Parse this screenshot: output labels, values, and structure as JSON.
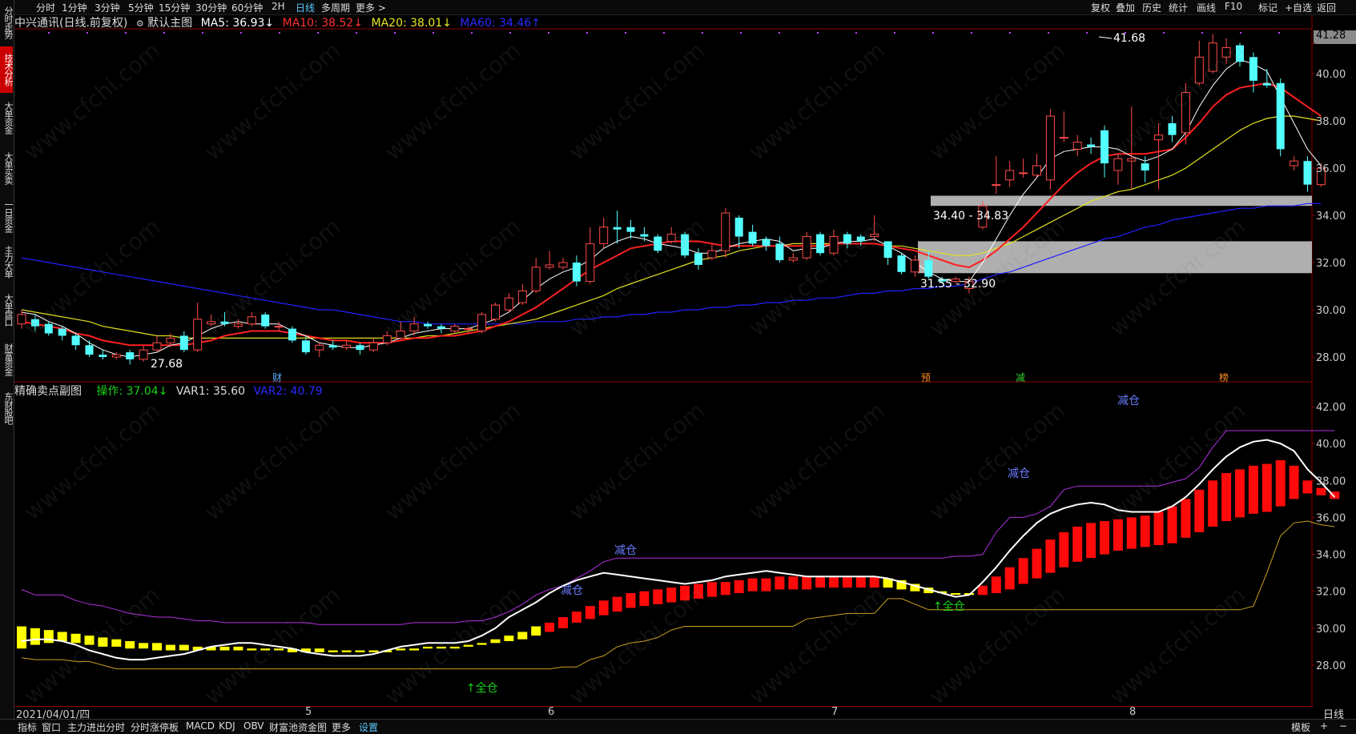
{
  "left_tabs": [
    "分时走势",
    "技术分析",
    "大单资金",
    "大单买卖",
    "一日资金",
    "主力大单",
    "大单盘口",
    "财富资金",
    "东财股吧"
  ],
  "active_left_tab": 1,
  "timeframes": [
    "分时",
    "1分钟",
    "3分钟",
    "5分钟",
    "15分钟",
    "30分钟",
    "60分钟",
    "2H",
    "日线",
    "多周期",
    "更多 >"
  ],
  "active_timeframe": "日线",
  "right_buttons": [
    "复权",
    "叠加",
    "历史",
    "统计",
    "画线",
    "F10",
    "标记",
    "+自选",
    "返回"
  ],
  "main_chart": {
    "stock_title": "中兴通讯(日线.前复权)",
    "template_label": "默认主图",
    "ma5": "MA5: 36.93↓",
    "ma10": "MA10: 38.52↓",
    "ma20": "MA20: 38.01↓",
    "ma60": "MA60: 34.46↑",
    "colors": {
      "ma5": "#ffffff",
      "ma10": "#ff2020",
      "ma20": "#e0e020",
      "ma60": "#2020ff",
      "up": "#ff4a4a",
      "down": "#54ffff"
    },
    "high_label": "41.68",
    "low_label": "27.68",
    "zone_upper_label": "34.40 - 34.83",
    "zone_lower_label": "31.55 - 32.90",
    "markers": [
      "财",
      "预",
      "减",
      "榜"
    ],
    "axis_ticks": [
      "41.28",
      "40.00",
      "38.00",
      "36.00",
      "34.00",
      "32.00",
      "30.00",
      "28.00"
    ]
  },
  "sub_chart": {
    "title": "精确卖点副图",
    "op": "操作: 37.04↓",
    "var1": "VAR1: 35.60",
    "var2": "VAR2: 40.79",
    "labels": [
      "减仓",
      "减仓",
      "减仓",
      "减仓",
      "全仓",
      "全仓"
    ],
    "axis_ticks": [
      "42.00",
      "40.00",
      "38.00",
      "36.00",
      "34.00",
      "32.00",
      "30.00",
      "28.00"
    ]
  },
  "date_axis": {
    "start": "2021/04/01/四",
    "months": [
      "5",
      "6",
      "7",
      "8"
    ],
    "right_label": "日线"
  },
  "bottom_buttons": [
    "指标",
    "窗口",
    "主力进出分时",
    "分时涨停板",
    "MACD",
    "KDJ",
    "OBV",
    "财富池资金图",
    "更多",
    "设置"
  ],
  "active_bottom": "设置",
  "bottom_right": [
    "模板",
    "+",
    "−"
  ],
  "watermark": "www.cfchi.com",
  "candles": [
    [
      29.4,
      29.8,
      29.2,
      30.0
    ],
    [
      29.6,
      29.3,
      29.1,
      29.8
    ],
    [
      29.4,
      29.0,
      28.9,
      29.5
    ],
    [
      29.2,
      28.9,
      28.7,
      29.3
    ],
    [
      28.9,
      28.5,
      28.3,
      29.0
    ],
    [
      28.5,
      28.1,
      28.0,
      28.7
    ],
    [
      28.1,
      28.0,
      27.9,
      28.3
    ],
    [
      28.0,
      28.1,
      27.9,
      28.2
    ],
    [
      28.2,
      27.9,
      27.68,
      28.3
    ],
    [
      27.9,
      28.3,
      27.8,
      28.5
    ],
    [
      28.3,
      28.6,
      28.2,
      28.9
    ],
    [
      28.6,
      28.8,
      28.4,
      29.0
    ],
    [
      28.9,
      28.3,
      28.2,
      29.1
    ],
    [
      28.3,
      29.6,
      28.2,
      30.3
    ],
    [
      29.4,
      29.5,
      29.3,
      29.8
    ],
    [
      29.5,
      29.4,
      29.3,
      29.9
    ],
    [
      29.3,
      29.4,
      29.2,
      29.6
    ],
    [
      29.4,
      29.7,
      29.3,
      29.9
    ],
    [
      29.8,
      29.3,
      29.2,
      29.9
    ],
    [
      29.3,
      29.3,
      29.1,
      29.5
    ],
    [
      29.2,
      28.7,
      28.6,
      29.3
    ],
    [
      28.7,
      28.2,
      28.1,
      28.9
    ],
    [
      28.3,
      28.5,
      28.0,
      28.6
    ],
    [
      28.5,
      28.4,
      28.3,
      28.7
    ],
    [
      28.4,
      28.5,
      28.3,
      28.7
    ],
    [
      28.5,
      28.3,
      28.1,
      28.6
    ],
    [
      28.3,
      28.6,
      28.2,
      28.8
    ],
    [
      28.6,
      28.9,
      28.5,
      29.1
    ],
    [
      28.8,
      29.1,
      28.7,
      29.5
    ],
    [
      29.1,
      29.4,
      28.9,
      29.7
    ],
    [
      29.4,
      29.3,
      29.2,
      29.5
    ],
    [
      29.3,
      29.2,
      29.0,
      29.4
    ],
    [
      29.1,
      29.3,
      29.0,
      29.4
    ],
    [
      29.2,
      29.2,
      29.0,
      29.3
    ],
    [
      29.1,
      29.8,
      29.0,
      29.9
    ],
    [
      29.6,
      30.2,
      29.5,
      30.3
    ],
    [
      30.0,
      30.5,
      29.9,
      30.7
    ],
    [
      30.3,
      30.8,
      30.2,
      31.1
    ],
    [
      30.8,
      31.8,
      30.7,
      32.2
    ],
    [
      31.8,
      31.9,
      31.7,
      32.5
    ],
    [
      31.8,
      32.0,
      31.7,
      32.2
    ],
    [
      32.0,
      31.2,
      31.0,
      32.3
    ],
    [
      31.2,
      32.8,
      31.1,
      33.5
    ],
    [
      32.8,
      33.5,
      32.6,
      33.9
    ],
    [
      33.5,
      33.4,
      32.8,
      34.2
    ],
    [
      33.5,
      33.3,
      33.0,
      33.8
    ],
    [
      33.2,
      33.1,
      32.9,
      33.5
    ],
    [
      33.1,
      32.5,
      32.4,
      33.2
    ],
    [
      32.9,
      33.2,
      32.8,
      33.5
    ],
    [
      33.2,
      32.3,
      32.2,
      33.3
    ],
    [
      32.4,
      31.9,
      31.7,
      32.6
    ],
    [
      32.2,
      32.5,
      32.1,
      32.8
    ],
    [
      32.5,
      34.1,
      32.2,
      34.3
    ],
    [
      33.9,
      33.1,
      32.6,
      34.0
    ],
    [
      33.3,
      32.8,
      32.7,
      33.6
    ],
    [
      33.0,
      32.7,
      32.5,
      33.1
    ],
    [
      32.8,
      32.1,
      32.0,
      33.1
    ],
    [
      32.1,
      32.2,
      32.0,
      32.4
    ],
    [
      32.2,
      33.1,
      32.1,
      33.3
    ],
    [
      33.2,
      32.4,
      32.3,
      33.3
    ],
    [
      32.4,
      33.1,
      32.3,
      33.4
    ],
    [
      33.2,
      32.8,
      32.6,
      33.3
    ],
    [
      33.1,
      32.9,
      32.7,
      33.2
    ],
    [
      33.1,
      33.2,
      32.9,
      34.0
    ],
    [
      32.9,
      32.2,
      31.9,
      32.9
    ],
    [
      32.3,
      31.6,
      31.5,
      32.4
    ],
    [
      31.6,
      32.1,
      31.4,
      32.3
    ],
    [
      32.1,
      31.4,
      31.3,
      32.5
    ],
    [
      31.3,
      31.2,
      31.1,
      31.4
    ],
    [
      31.2,
      31.3,
      31.1,
      31.4
    ],
    [
      30.9,
      31.2,
      30.7,
      31.4
    ],
    [
      33.5,
      34.4,
      33.4,
      34.6
    ],
    [
      35.3,
      35.3,
      34.9,
      36.5
    ],
    [
      35.5,
      35.9,
      35.2,
      36.3
    ],
    [
      35.8,
      35.8,
      35.6,
      36.4
    ],
    [
      35.7,
      36.1,
      35.6,
      36.6
    ],
    [
      35.5,
      38.2,
      35.1,
      38.5
    ],
    [
      37.3,
      37.3,
      37.1,
      38.4
    ],
    [
      36.8,
      37.1,
      36.5,
      37.4
    ],
    [
      37.0,
      36.9,
      36.6,
      37.3
    ],
    [
      37.6,
      36.2,
      35.6,
      37.8
    ],
    [
      35.9,
      36.4,
      35.3,
      36.6
    ],
    [
      36.3,
      36.4,
      35.1,
      38.6
    ],
    [
      36.2,
      35.9,
      35.4,
      36.5
    ],
    [
      37.2,
      37.4,
      35.1,
      37.9
    ],
    [
      37.9,
      37.4,
      37.1,
      38.2
    ],
    [
      37.5,
      39.2,
      37.0,
      39.6
    ],
    [
      39.6,
      40.7,
      39.5,
      41.4
    ],
    [
      40.1,
      41.3,
      40.0,
      41.68
    ],
    [
      40.7,
      41.1,
      40.4,
      41.5
    ],
    [
      41.2,
      40.5,
      40.3,
      41.3
    ],
    [
      40.7,
      39.7,
      39.2,
      40.9
    ],
    [
      39.6,
      39.5,
      39.4,
      40.2
    ],
    [
      39.6,
      36.8,
      36.5,
      39.8
    ],
    [
      36.1,
      36.3,
      35.9,
      36.5
    ],
    [
      36.3,
      35.3,
      35.0,
      36.5
    ],
    [
      35.3,
      36.0,
      35.2,
      36.2
    ]
  ],
  "ma5_series": [
    29.9,
    29.8,
    29.5,
    29.3,
    29.0,
    28.6,
    28.3,
    28.1,
    28.0,
    28.1,
    28.2,
    28.5,
    28.6,
    28.9,
    29.2,
    29.4,
    29.5,
    29.4,
    29.4,
    29.4,
    29.1,
    28.9,
    28.6,
    28.5,
    28.4,
    28.4,
    28.5,
    28.6,
    28.8,
    29.0,
    29.1,
    29.2,
    29.2,
    29.2,
    29.4,
    29.6,
    29.9,
    30.4,
    30.9,
    31.3,
    31.6,
    31.8,
    32.1,
    32.6,
    32.9,
    33.1,
    33.0,
    32.8,
    32.7,
    32.6,
    32.4,
    32.4,
    32.6,
    32.8,
    32.9,
    33.0,
    32.9,
    32.5,
    32.6,
    32.6,
    32.8,
    32.9,
    32.9,
    33.0,
    32.7,
    32.4,
    32.0,
    31.6,
    31.3,
    31.2,
    31.2,
    32.0,
    33.0,
    34.0,
    34.9,
    35.6,
    36.4,
    36.7,
    36.8,
    36.9,
    36.9,
    36.8,
    36.5,
    36.3,
    36.5,
    36.8,
    37.5,
    38.6,
    39.5,
    40.2,
    40.6,
    40.4,
    40.1,
    39.0,
    37.9,
    36.8,
    36.1
  ],
  "ma10_series": [
    29.5,
    29.4,
    29.3,
    29.2,
    29.0,
    28.9,
    28.7,
    28.6,
    28.5,
    28.5,
    28.5,
    28.5,
    28.5,
    28.6,
    28.7,
    28.9,
    29.0,
    29.1,
    29.1,
    29.1,
    29.0,
    28.9,
    28.8,
    28.7,
    28.7,
    28.6,
    28.6,
    28.6,
    28.7,
    28.8,
    28.8,
    28.9,
    28.9,
    29.0,
    29.1,
    29.3,
    29.5,
    29.8,
    30.1,
    30.5,
    30.9,
    31.3,
    31.7,
    32.0,
    32.3,
    32.6,
    32.7,
    32.8,
    32.9,
    32.9,
    32.9,
    32.8,
    32.7,
    32.7,
    32.7,
    32.7,
    32.7,
    32.7,
    32.7,
    32.7,
    32.8,
    32.8,
    32.8,
    32.8,
    32.7,
    32.6,
    32.5,
    32.3,
    32.1,
    31.9,
    31.8,
    32.1,
    32.5,
    33.0,
    33.5,
    34.1,
    34.7,
    35.3,
    35.8,
    36.2,
    36.5,
    36.6,
    36.6,
    36.6,
    36.7,
    36.8,
    37.3,
    37.9,
    38.6,
    39.1,
    39.4,
    39.5,
    39.6,
    39.4,
    39.0,
    38.6,
    38.2
  ],
  "ma20_series": [
    30.0,
    29.9,
    29.8,
    29.7,
    29.6,
    29.5,
    29.3,
    29.2,
    29.1,
    29.0,
    28.9,
    28.9,
    28.8,
    28.8,
    28.8,
    28.8,
    28.8,
    28.8,
    28.8,
    28.8,
    28.8,
    28.8,
    28.8,
    28.8,
    28.8,
    28.8,
    28.8,
    28.8,
    28.8,
    28.8,
    28.9,
    28.9,
    29.0,
    29.1,
    29.2,
    29.3,
    29.4,
    29.5,
    29.6,
    29.8,
    30.0,
    30.2,
    30.4,
    30.6,
    30.9,
    31.1,
    31.3,
    31.5,
    31.7,
    31.9,
    32.1,
    32.2,
    32.3,
    32.5,
    32.6,
    32.7,
    32.7,
    32.8,
    32.8,
    32.8,
    32.8,
    32.8,
    32.8,
    32.8,
    32.7,
    32.7,
    32.6,
    32.5,
    32.4,
    32.3,
    32.3,
    32.4,
    32.6,
    32.8,
    33.1,
    33.4,
    33.7,
    34.0,
    34.3,
    34.6,
    34.8,
    35.0,
    35.1,
    35.3,
    35.5,
    35.7,
    36.0,
    36.4,
    36.8,
    37.2,
    37.6,
    37.9,
    38.1,
    38.2,
    38.2,
    38.1,
    38.0
  ],
  "ma60_series": [
    32.2,
    32.1,
    32.0,
    31.9,
    31.8,
    31.7,
    31.6,
    31.5,
    31.4,
    31.3,
    31.2,
    31.1,
    31.0,
    30.9,
    30.8,
    30.7,
    30.6,
    30.5,
    30.4,
    30.3,
    30.2,
    30.1,
    30.0,
    30.0,
    29.9,
    29.8,
    29.7,
    29.6,
    29.5,
    29.5,
    29.4,
    29.4,
    29.4,
    29.4,
    29.4,
    29.4,
    29.4,
    29.4,
    29.5,
    29.5,
    29.5,
    29.6,
    29.6,
    29.7,
    29.7,
    29.8,
    29.8,
    29.9,
    29.9,
    30.0,
    30.0,
    30.1,
    30.1,
    30.2,
    30.2,
    30.3,
    30.3,
    30.4,
    30.4,
    30.5,
    30.5,
    30.6,
    30.7,
    30.7,
    30.8,
    30.8,
    30.9,
    30.9,
    31.0,
    31.0,
    31.1,
    31.3,
    31.5,
    31.6,
    31.8,
    32.0,
    32.2,
    32.4,
    32.6,
    32.8,
    33.0,
    33.1,
    33.3,
    33.5,
    33.6,
    33.8,
    33.9,
    34.0,
    34.1,
    34.2,
    34.3,
    34.3,
    34.4,
    34.4,
    34.4,
    34.5,
    34.5
  ],
  "sub_white_series": [
    29.3,
    29.4,
    29.4,
    29.3,
    29.1,
    28.8,
    28.6,
    28.4,
    28.3,
    28.3,
    28.4,
    28.5,
    28.6,
    28.8,
    29.0,
    29.1,
    29.2,
    29.2,
    29.1,
    29.0,
    28.9,
    28.7,
    28.6,
    28.5,
    28.5,
    28.5,
    28.6,
    28.8,
    29.0,
    29.1,
    29.2,
    29.2,
    29.2,
    29.3,
    29.6,
    30.0,
    30.6,
    31.0,
    31.4,
    31.9,
    32.3,
    32.6,
    32.8,
    33.0,
    32.9,
    32.8,
    32.7,
    32.6,
    32.5,
    32.4,
    32.5,
    32.6,
    32.8,
    32.9,
    33.0,
    33.1,
    33.0,
    32.9,
    32.8,
    32.8,
    32.8,
    32.8,
    32.8,
    32.8,
    32.7,
    32.5,
    32.3,
    32.1,
    31.9,
    31.7,
    31.8,
    32.5,
    33.3,
    34.2,
    35.0,
    35.7,
    36.2,
    36.5,
    36.7,
    36.8,
    36.7,
    36.4,
    36.3,
    36.3,
    36.3,
    36.6,
    37.1,
    37.8,
    38.6,
    39.3,
    39.8,
    40.1,
    40.2,
    40.0,
    39.6,
    38.6,
    37.9,
    37.1
  ],
  "sub_purple_series": [
    32.1,
    31.8,
    31.8,
    31.8,
    31.5,
    31.3,
    31.2,
    31.0,
    30.8,
    30.7,
    30.6,
    30.6,
    30.5,
    30.4,
    30.4,
    30.3,
    30.3,
    30.3,
    30.3,
    30.3,
    30.3,
    30.3,
    30.2,
    30.2,
    30.2,
    30.2,
    30.2,
    30.2,
    30.2,
    30.3,
    30.3,
    30.3,
    30.3,
    30.4,
    30.4,
    30.6,
    30.9,
    31.3,
    31.8,
    32.1,
    32.3,
    32.7,
    33.1,
    33.6,
    33.8,
    33.8,
    33.8,
    33.8,
    33.8,
    33.8,
    33.8,
    33.8,
    33.8,
    33.8,
    33.8,
    33.8,
    33.8,
    33.8,
    33.8,
    33.8,
    33.8,
    33.8,
    33.8,
    33.8,
    33.8,
    33.8,
    33.8,
    33.8,
    33.8,
    33.9,
    33.9,
    34.0,
    35.2,
    36.0,
    36.0,
    36.2,
    36.6,
    37.5,
    37.7,
    37.7,
    37.7,
    37.7,
    37.7,
    37.7,
    37.7,
    37.9,
    38.1,
    38.7,
    39.8,
    40.7,
    40.7,
    40.7,
    40.7,
    40.7,
    40.7,
    40.7,
    40.7,
    40.7
  ],
  "sub_gold_series": [
    28.4,
    28.3,
    28.3,
    28.3,
    28.2,
    28.2,
    28.0,
    27.8,
    27.8,
    27.8,
    27.8,
    27.8,
    27.8,
    27.8,
    27.8,
    27.8,
    27.8,
    27.8,
    27.8,
    27.8,
    27.8,
    27.8,
    27.8,
    27.8,
    27.8,
    27.8,
    27.8,
    27.8,
    27.8,
    27.8,
    27.8,
    27.8,
    27.8,
    27.8,
    27.8,
    27.8,
    27.8,
    27.8,
    27.8,
    27.8,
    27.9,
    27.9,
    28.3,
    28.5,
    29.0,
    29.2,
    29.3,
    29.5,
    29.9,
    30.1,
    30.1,
    30.1,
    30.1,
    30.1,
    30.1,
    30.1,
    30.1,
    30.1,
    30.5,
    30.6,
    30.7,
    30.8,
    30.8,
    30.8,
    31.6,
    31.6,
    31.3,
    31.0,
    31.0,
    31.0,
    31.0,
    31.0,
    31.0,
    31.0,
    31.0,
    31.0,
    31.0,
    31.0,
    31.0,
    31.0,
    31.0,
    31.0,
    31.0,
    31.0,
    31.0,
    31.0,
    31.0,
    31.0,
    31.0,
    31.0,
    31.0,
    31.2,
    33.0,
    35.0,
    35.7,
    35.8,
    35.6,
    35.5
  ],
  "sub_bars": [
    [
      28.9,
      30.1
    ],
    [
      29.1,
      30.0
    ],
    [
      29.2,
      29.9
    ],
    [
      29.3,
      29.8
    ],
    [
      29.2,
      29.7
    ],
    [
      29.1,
      29.6
    ],
    [
      29.0,
      29.5
    ],
    [
      29.0,
      29.4
    ],
    [
      28.9,
      29.3
    ],
    [
      28.9,
      29.2
    ],
    [
      28.8,
      29.2
    ],
    [
      28.8,
      29.1
    ],
    [
      28.8,
      29.1
    ],
    [
      28.8,
      29.0
    ],
    [
      28.8,
      29.0
    ],
    [
      28.8,
      29.0
    ],
    [
      28.8,
      29.0
    ],
    [
      28.8,
      28.9
    ],
    [
      28.8,
      28.9
    ],
    [
      28.8,
      28.9
    ],
    [
      28.7,
      28.9
    ],
    [
      28.7,
      28.9
    ],
    [
      28.7,
      28.9
    ],
    [
      28.7,
      28.8
    ],
    [
      28.7,
      28.8
    ],
    [
      28.7,
      28.8
    ],
    [
      28.7,
      28.8
    ],
    [
      28.7,
      28.8
    ],
    [
      28.8,
      28.9
    ],
    [
      28.8,
      28.9
    ],
    [
      28.9,
      29.0
    ],
    [
      28.9,
      29.0
    ],
    [
      28.9,
      29.0
    ],
    [
      29.0,
      29.1
    ],
    [
      29.1,
      29.2
    ],
    [
      29.2,
      29.4
    ],
    [
      29.3,
      29.6
    ],
    [
      29.4,
      29.8
    ],
    [
      29.6,
      30.1
    ],
    [
      29.8,
      30.3
    ],
    [
      30.0,
      30.6
    ],
    [
      30.3,
      30.9
    ],
    [
      30.5,
      31.2
    ],
    [
      30.7,
      31.5
    ],
    [
      30.9,
      31.7
    ],
    [
      31.1,
      31.9
    ],
    [
      31.2,
      32.0
    ],
    [
      31.3,
      32.1
    ],
    [
      31.4,
      32.2
    ],
    [
      31.5,
      32.3
    ],
    [
      31.6,
      32.4
    ],
    [
      31.7,
      32.5
    ],
    [
      31.8,
      32.5
    ],
    [
      31.9,
      32.6
    ],
    [
      32.0,
      32.7
    ],
    [
      32.0,
      32.7
    ],
    [
      32.1,
      32.8
    ],
    [
      32.1,
      32.8
    ],
    [
      32.1,
      32.8
    ],
    [
      32.2,
      32.8
    ],
    [
      32.2,
      32.8
    ],
    [
      32.2,
      32.8
    ],
    [
      32.2,
      32.8
    ],
    [
      32.2,
      32.8
    ],
    [
      32.2,
      32.7
    ],
    [
      32.1,
      32.6
    ],
    [
      32.0,
      32.4
    ],
    [
      31.9,
      32.2
    ],
    [
      31.9,
      32.0
    ],
    [
      31.9,
      31.9
    ],
    [
      31.8,
      31.9
    ],
    [
      31.8,
      32.3
    ],
    [
      31.9,
      32.8
    ],
    [
      32.1,
      33.3
    ],
    [
      32.4,
      33.8
    ],
    [
      32.7,
      34.3
    ],
    [
      33.0,
      34.8
    ],
    [
      33.3,
      35.2
    ],
    [
      33.6,
      35.5
    ],
    [
      33.8,
      35.7
    ],
    [
      34.0,
      35.8
    ],
    [
      34.2,
      35.9
    ],
    [
      34.3,
      36.0
    ],
    [
      34.4,
      36.1
    ],
    [
      34.5,
      36.3
    ],
    [
      34.6,
      36.6
    ],
    [
      34.9,
      37.0
    ],
    [
      35.2,
      37.5
    ],
    [
      35.5,
      38.0
    ],
    [
      35.8,
      38.4
    ],
    [
      36.0,
      38.6
    ],
    [
      36.2,
      38.8
    ],
    [
      36.3,
      38.9
    ],
    [
      36.6,
      39.1
    ],
    [
      37.0,
      38.8
    ],
    [
      37.3,
      38.0
    ],
    [
      37.2,
      37.6
    ],
    [
      37.0,
      37.4
    ]
  ]
}
